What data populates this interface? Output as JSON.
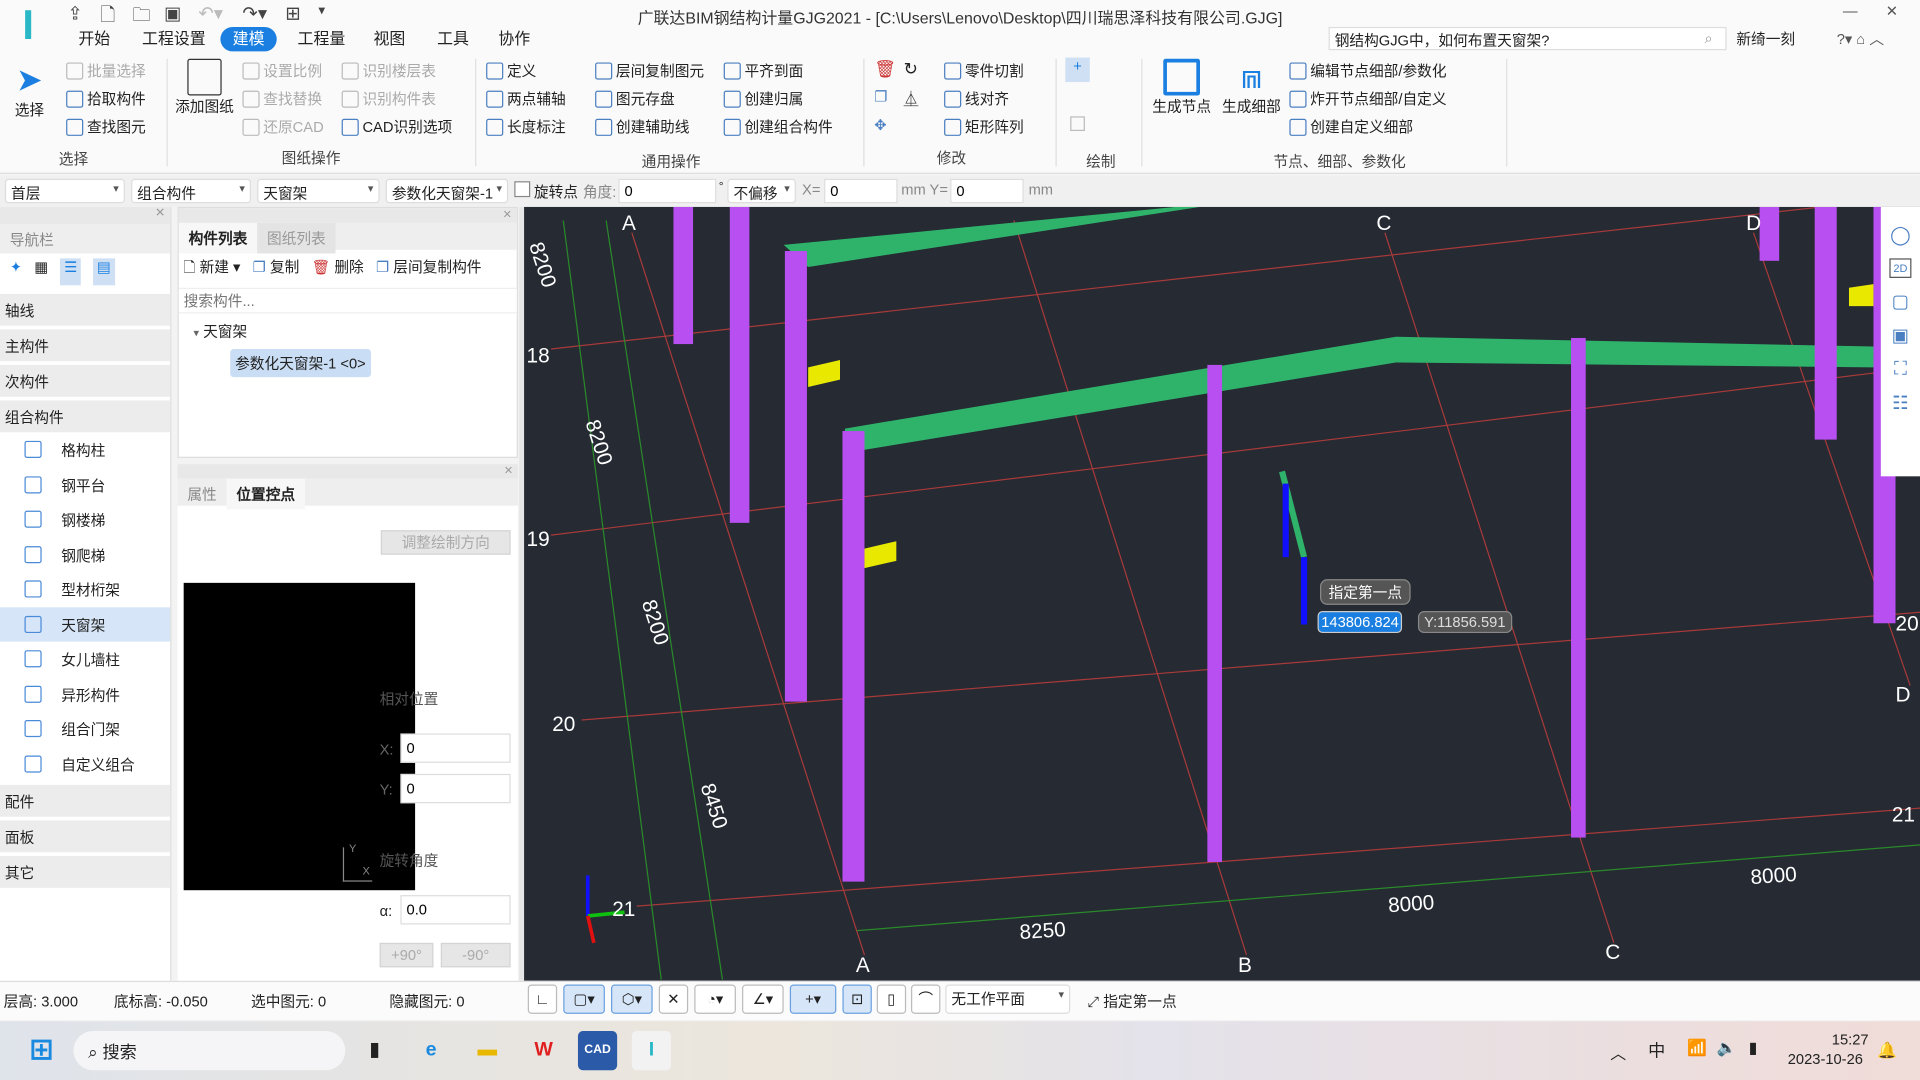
{
  "app": {
    "title": "广联达BIM钢结构计量GJG2021 - [C:\\Users\\Lenovo\\Desktop\\四川瑞思泽科技有限公司.GJG]",
    "logo": "I"
  },
  "menu": [
    "开始",
    "工程设置",
    "建模",
    "工程量",
    "视图",
    "工具",
    "协作"
  ],
  "menu_active": "建模",
  "help_search": "钢结构GJG中，如何布置天窗架?",
  "user": "新绮一刻",
  "ribbon": {
    "select": {
      "big": "选择",
      "items": [
        "批量选择",
        "拾取构件",
        "查找图元"
      ],
      "group": "选择"
    },
    "drawing": {
      "big": "添加图纸",
      "items": [
        "设置比例",
        "查找替换",
        "还原CAD",
        "识别楼层表",
        "识别构件表",
        "CAD识别选项"
      ],
      "group": "图纸操作"
    },
    "common": {
      "items": [
        "定义",
        "两点辅轴",
        "长度标注",
        "层间复制图元",
        "图元存盘",
        "创建辅助线",
        "平齐到面",
        "创建归属",
        "创建组合构件"
      ],
      "group": "通用操作"
    },
    "modify": {
      "items": [
        "零件切割",
        "线对齐",
        "矩形阵列"
      ],
      "group": "修改"
    },
    "draw": {
      "group": "绘制"
    },
    "node": {
      "big": [
        "生成节点",
        "生成细部"
      ],
      "items": [
        "编辑节点细部/参数化",
        "炸开节点细部/自定义",
        "创建自定义细部"
      ],
      "group": "节点、细部、参数化"
    }
  },
  "options": {
    "floor": "首层",
    "type": "组合构件",
    "sub": "天窗架",
    "component": "参数化天窗架-1",
    "rotate_label": "旋转点",
    "angle_label": "角度:",
    "angle": "0",
    "deg": "°",
    "offset": "不偏移",
    "x_label": "X=",
    "x": "0",
    "y_label": "mm Y=",
    "y": "0",
    "unit": "mm"
  },
  "nav": {
    "title": "导航栏",
    "categories": [
      "轴线",
      "主构件",
      "次构件",
      "组合构件",
      "配件",
      "面板",
      "其它"
    ],
    "items": [
      "格构柱",
      "钢平台",
      "钢楼梯",
      "钢爬梯",
      "型材桁架",
      "天窗架",
      "女儿墙柱",
      "异形构件",
      "组合门架",
      "自定义组合"
    ],
    "active": "天窗架"
  },
  "component_list": {
    "tabs": [
      "构件列表",
      "图纸列表"
    ],
    "actions": [
      "新建",
      "复制",
      "删除",
      "层间复制构件"
    ],
    "search_placeholder": "搜索构件...",
    "tree_parent": "天窗架",
    "tree_child": "参数化天窗架-1 <0>"
  },
  "props": {
    "tabs": [
      "属性",
      "位置控点"
    ],
    "adjust": "调整绘制方向",
    "rel_pos": "相对位置",
    "x_label": "X:",
    "x": "0",
    "y_label": "Y:",
    "y": "0",
    "rot_label": "旋转角度",
    "alpha_label": "α:",
    "alpha": "0.0",
    "plus90": "+90°",
    "minus90": "-90°",
    "axis_x": "X",
    "axis_y": "Y"
  },
  "viewport": {
    "axis_letters": [
      "A",
      "C",
      "D",
      "A",
      "B",
      "C",
      "D"
    ],
    "axis_numbers": [
      "18",
      "19",
      "20",
      "21",
      "20",
      "21"
    ],
    "dims": [
      "8200",
      "8200",
      "8200",
      "8450",
      "8250",
      "8000",
      "8000"
    ],
    "prompt": "指定第一点",
    "coord_x": "143806.824",
    "coord_y": "Y:11856.591",
    "colors": {
      "column": "#b84ff0",
      "beam": "#2fb36a",
      "grid_red": "#a83a3a",
      "grid_green": "#2a8a2a"
    }
  },
  "status": {
    "floor_h": "层高: 3.000",
    "base_h": "底标高: -0.050",
    "selected": "选中图元: 0",
    "hidden": "隐藏图元: 0",
    "work_plane": "无工作平面",
    "hint": "指定第一点"
  },
  "taskbar": {
    "search": "搜索",
    "time": "15:27",
    "date": "2023-10-26",
    "ime": "中"
  }
}
